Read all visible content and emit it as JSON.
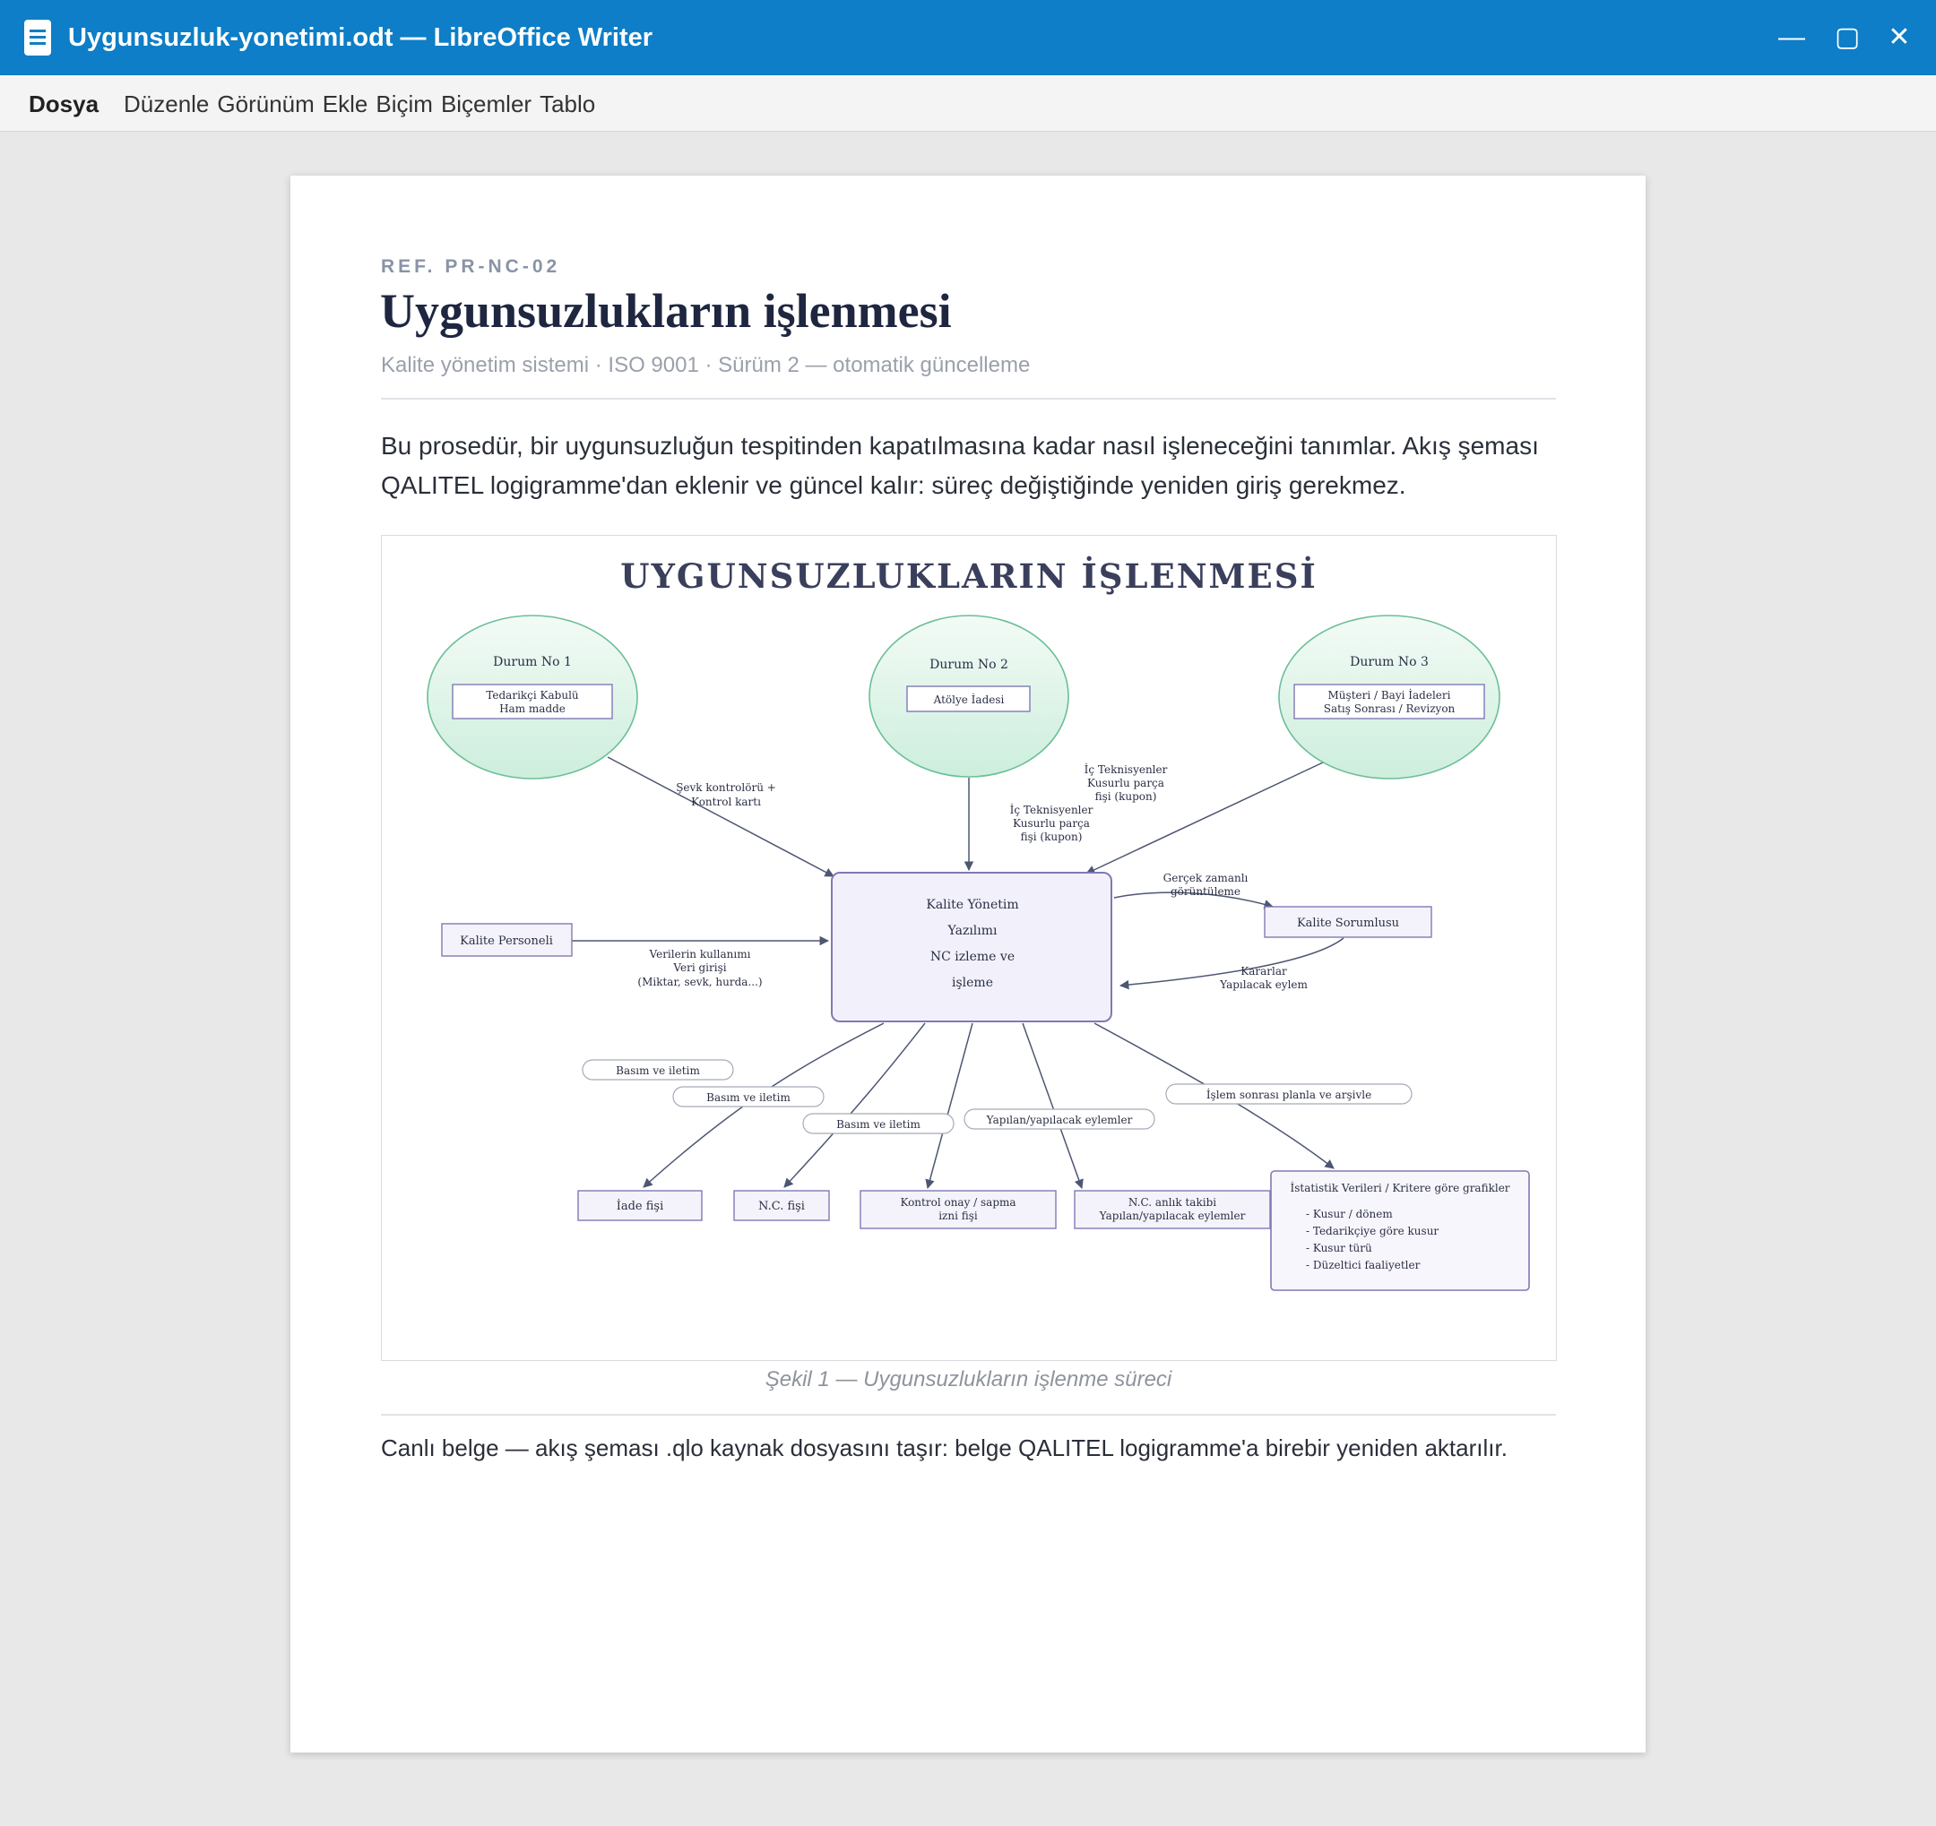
{
  "window": {
    "title": "Uygunsuzluk-yonetimi.odt — LibreOffice Writer",
    "controls": {
      "minimize": "—",
      "maximize": "▢",
      "close": "✕"
    }
  },
  "menu": {
    "file": "Dosya",
    "items": [
      "Düzenle",
      "Görünüm",
      "Ekle",
      "Biçim",
      "Biçemler",
      "Tablo"
    ]
  },
  "document": {
    "ref": "REF. PR-NC-02",
    "title": "Uygunsuzlukların işlenmesi",
    "subtitle": "Kalite yönetim sistemi · ISO 9001 · Sürüm 2 — otomatik güncelleme",
    "intro": "Bu prosedür, bir uygunsuzluğun tespitinden kapatılmasına kadar nasıl işleneceğini tanımlar. Akış şeması QALITEL logigramme'dan eklenir ve güncel kalır: süreç değiştiğinde yeniden giriş gerekmez.",
    "caption": "Şekil 1 — Uygunsuzlukların işlenme süreci",
    "footer": "Canlı belge — akış şeması .qlo kaynak dosyasını taşır: belge QALITEL logigramme'a birebir yeniden aktarılır."
  },
  "diagram": {
    "title": "UYGUNSUZLUKLARIN İŞLENMESİ",
    "case1": {
      "label": "Durum No 1",
      "line1": "Tedarikçi Kabulü",
      "line2": "Ham madde"
    },
    "case2": {
      "label": "Durum No 2",
      "line1": "Atölye İadesi"
    },
    "case3": {
      "label": "Durum No 3",
      "line1": "Müşteri / Bayi İadeleri",
      "line2": "Satış Sonrası / Revizyon"
    },
    "center": {
      "line1": "Kalite Yönetim",
      "line2": "Yazılımı",
      "line3": "NC izleme ve",
      "line4": "işleme"
    },
    "edge_case1": {
      "line1": "Şevk kontrolörü +",
      "line2": "Kontrol kartı"
    },
    "edge_case2": {
      "line1": "İç Teknisyenler",
      "line2": "Kusurlu parça",
      "line3": "fişi (kupon)"
    },
    "edge_case3": {
      "line1": "İç Teknisyenler",
      "line2": "Kusurlu parça",
      "line3": "fişi (kupon)"
    },
    "staff": "Kalite Personeli",
    "edge_staff": {
      "line1": "Verilerin kullanımı",
      "line2": "Veri girişi",
      "line3": "(Miktar, sevk, hurda...)"
    },
    "manager": "Kalite Sorumlusu",
    "edge_manager_in": {
      "line1": "Gerçek zamanlı",
      "line2": "görüntüleme"
    },
    "edge_manager_out": {
      "line1": "Kararlar",
      "line2": "Yapılacak eylem"
    },
    "pills": {
      "p1": "Basım ve iletim",
      "p2": "Basım ve iletim",
      "p3": "Basım ve iletim",
      "p4": "Yapılan/yapılacak eylemler",
      "p5": "İşlem sonrası planla ve arşivle"
    },
    "outputs": {
      "o1": "İade fişi",
      "o2": "N.C. fişi",
      "o3": {
        "line1": "Kontrol onay / sapma",
        "line2": "izni fişi"
      },
      "o4": {
        "line1": "N.C. anlık takibi",
        "line2": "Yapılan/yapılacak eylemler"
      }
    },
    "stats": {
      "title": "İstatistik Verileri / Kritere göre grafikler",
      "items": [
        "- Kusur / dönem",
        "- Tedarikçiye göre kusur",
        "- Kusur türü",
        "- Düzeltici faaliyetler"
      ]
    }
  }
}
